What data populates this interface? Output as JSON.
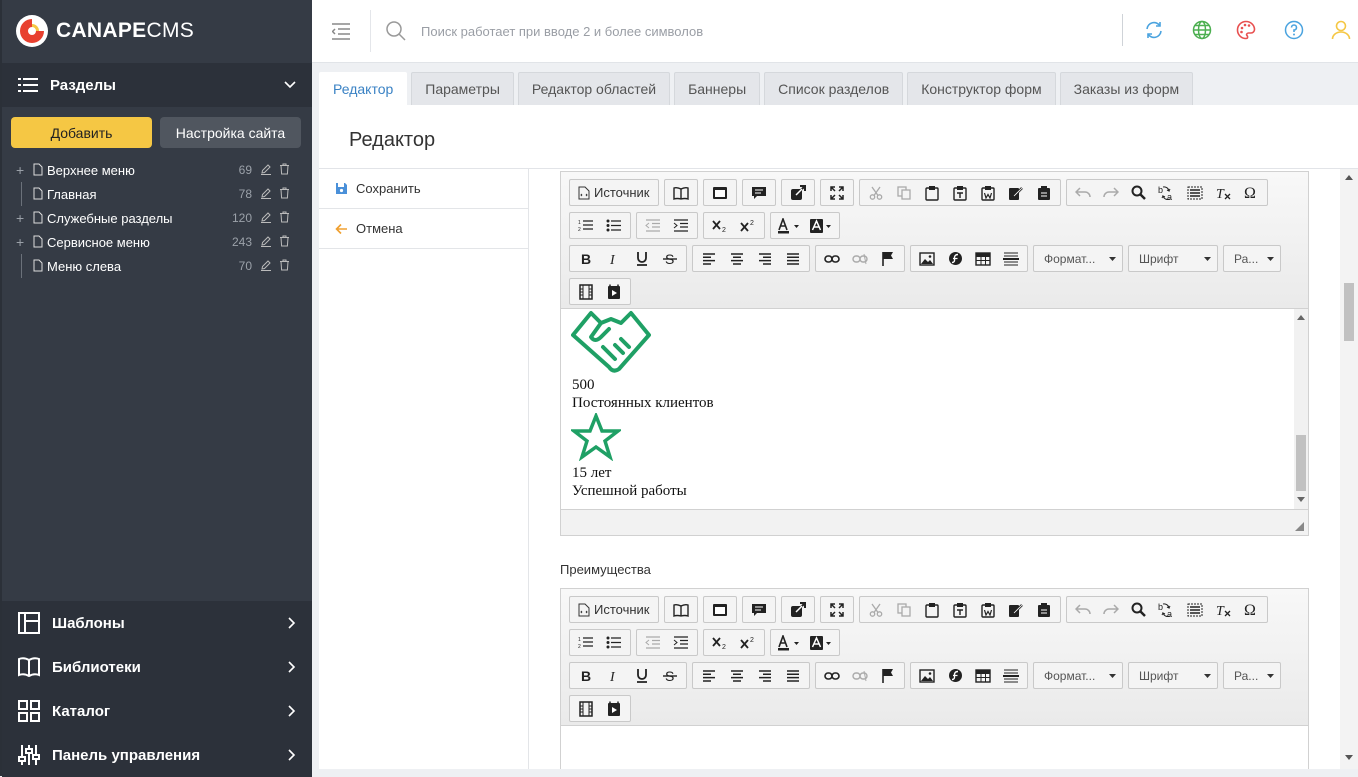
{
  "brand": {
    "bold": "CANAPE",
    "rest": "CMS",
    "accent": "#e8402f"
  },
  "sidebar": {
    "section_title": "Разделы",
    "add_label": "Добавить",
    "settings_label": "Настройка сайта",
    "tree": [
      {
        "label": "Верхнее меню",
        "count": "69",
        "expandable": true
      },
      {
        "label": "Главная",
        "count": "78",
        "expandable": false
      },
      {
        "label": "Служебные разделы",
        "count": "120",
        "expandable": true
      },
      {
        "label": "Сервисное меню",
        "count": "243",
        "expandable": true
      },
      {
        "label": "Меню слева",
        "count": "70",
        "expandable": false
      }
    ],
    "bottom": [
      {
        "label": "Шаблоны",
        "icon": "layout-icon"
      },
      {
        "label": "Библиотеки",
        "icon": "book-icon"
      },
      {
        "label": "Каталог",
        "icon": "grid-icon"
      },
      {
        "label": "Панель управления",
        "icon": "sliders-icon"
      }
    ]
  },
  "topbar": {
    "search_placeholder": "Поиск работает при вводе 2 и более символов"
  },
  "tabs": [
    "Редактор",
    "Параметры",
    "Редактор областей",
    "Баннеры",
    "Список разделов",
    "Конструктор форм",
    "Заказы из форм"
  ],
  "page_title": "Редактор",
  "actions": {
    "save": "Сохранить",
    "cancel": "Отмена"
  },
  "editor": {
    "source_label": "Источник",
    "format_label": "Формат...",
    "font_label": "Шрифт",
    "size_label": "Ра...",
    "content": {
      "stat1_value": "500",
      "stat1_text": "Постоянных клиентов",
      "stat2_value": "15 лет",
      "stat2_text": "Успешной работы"
    },
    "icon_color": "#1fa065"
  },
  "field2_label": "Преимущества"
}
